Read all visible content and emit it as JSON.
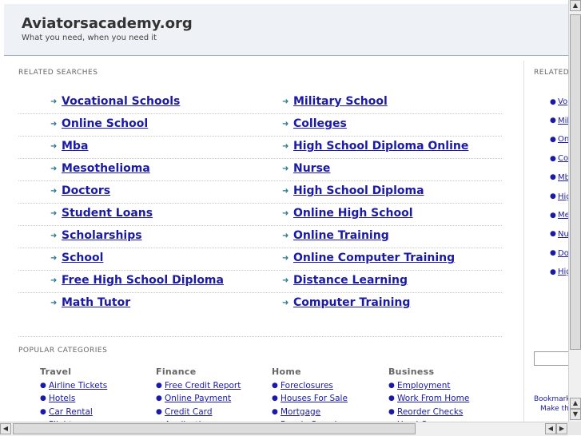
{
  "header": {
    "title": "Aviatorsacademy.org",
    "tagline": "What you need, when you need it"
  },
  "related": {
    "label": "RELATED SEARCHES",
    "left": [
      "Vocational Schools",
      "Online School",
      "Mba",
      "Mesothelioma",
      "Doctors",
      "Student Loans",
      "Scholarships",
      "School",
      "Free High School Diploma",
      "Math Tutor"
    ],
    "right": [
      "Military School",
      "Colleges",
      "High School Diploma Online",
      "Nurse",
      "High School Diploma",
      "Online High School",
      "Online Training",
      "Online Computer Training",
      "Distance Learning",
      "Computer Training"
    ]
  },
  "categories": {
    "label": "POPULAR CATEGORIES",
    "columns": [
      {
        "head": "Travel",
        "items": [
          "Airline Tickets",
          "Hotels",
          "Car Rental",
          "Flights"
        ]
      },
      {
        "head": "Finance",
        "items": [
          "Free Credit Report",
          "Online Payment",
          "Credit Card",
          "Application"
        ]
      },
      {
        "head": "Home",
        "items": [
          "Foreclosures",
          "Houses For Sale",
          "Mortgage",
          "People Search"
        ]
      },
      {
        "head": "Business",
        "items": [
          "Employment",
          "Work From Home",
          "Reorder Checks",
          "Used Cars"
        ]
      }
    ]
  },
  "side": {
    "label": "RELATED",
    "items": [
      "Vo",
      "Mil",
      "On",
      "Co",
      "Mb",
      "Hig",
      "Me",
      "Nu",
      "Do",
      "Hig"
    ],
    "note1": "Bookmark",
    "note2": "Make thi"
  },
  "icons": {
    "arrow": "arrow-right-icon",
    "bullet": "bullet-icon"
  },
  "colors": {
    "link": "#1a1aa6",
    "header_bg": "#eef2f6",
    "arrow": "#2a7a8a"
  }
}
